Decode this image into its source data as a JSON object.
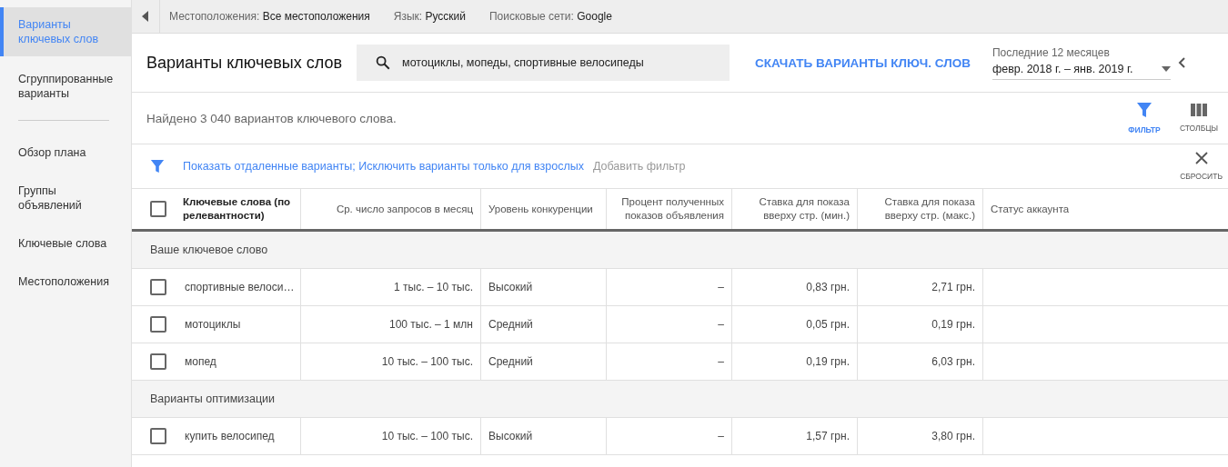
{
  "sidebar": {
    "items": [
      {
        "label": "Варианты ключевых слов",
        "selected": true
      },
      {
        "label": "Сгруппированные варианты",
        "selected": false
      },
      {
        "label": "Обзор плана",
        "selected": false
      },
      {
        "label": "Группы объявлений",
        "selected": false
      },
      {
        "label": "Ключевые слова",
        "selected": false
      },
      {
        "label": "Местоположения",
        "selected": false
      }
    ]
  },
  "top_bar": [
    {
      "label": "Местоположения:",
      "value": "Все местоположения"
    },
    {
      "label": "Язык:",
      "value": "Русский"
    },
    {
      "label": "Поисковые сети:",
      "value": "Google"
    }
  ],
  "header": {
    "title": "Варианты ключевых слов",
    "search": {
      "value": "мотоциклы, мопеды, спортивные велосипеды"
    },
    "download": "СКАЧАТЬ ВАРИАНТЫ КЛЮЧ. СЛОВ",
    "period": {
      "label": "Последние 12 месяцев",
      "value": "февр. 2018 г. – янв. 2019 г."
    }
  },
  "summary": "Найдено 3 040 вариантов ключевого слова.",
  "tools": [
    {
      "kind": "filter",
      "label": "ФИЛЬТР"
    },
    {
      "kind": "columns",
      "label": "СТОЛБЦЫ"
    }
  ],
  "filter_bar": {
    "filters": "Показать отдаленные варианты; Исключить варианты только для взрослых",
    "add": "Добавить фильтр",
    "reset": "СБРОСИТЬ"
  },
  "table": {
    "select_all": {
      "checked": false
    },
    "columns": [
      "Ключевые слова (по релевантности)",
      "Ср. число запросов в месяц",
      "Уровень конкуренции",
      "Процент полученных показов объявления",
      "Ставка для показа вверху стр. (мин.)",
      "Ставка для показа вверху стр. (макс.)",
      "Статус аккаунта"
    ],
    "groups": [
      {
        "title": "Ваше ключевое слово",
        "rows": [
          {
            "checked": false,
            "cells": [
              "спортивные велоси…",
              "1 тыс. – 10 тыс.",
              "Высокий",
              "–",
              "0,83 грн.",
              "2,71 грн."
            ]
          },
          {
            "checked": false,
            "cells": [
              "мотоциклы",
              "100 тыс. – 1 млн",
              "Средний",
              "–",
              "0,05 грн.",
              "0,19 грн."
            ]
          },
          {
            "checked": false,
            "cells": [
              "мопед",
              "10 тыс. – 100 тыс.",
              "Средний",
              "–",
              "0,19 грн.",
              "6,03 грн."
            ]
          }
        ]
      },
      {
        "title": "Варианты оптимизации",
        "rows": [
          {
            "checked": false,
            "cells": [
              "купить велосипед",
              "10 тыс. – 100 тыс.",
              "Высокий",
              "–",
              "1,57 грн.",
              "3,80 грн."
            ]
          }
        ]
      }
    ]
  }
}
